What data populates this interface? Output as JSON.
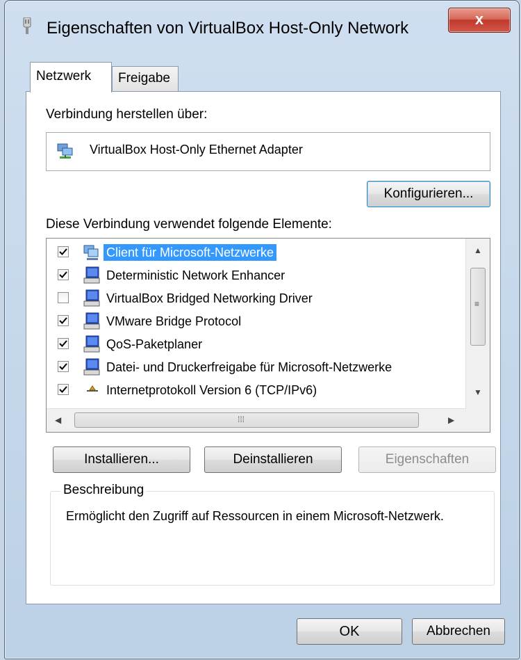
{
  "window": {
    "title": "Eigenschaften von VirtualBox Host-Only Network",
    "close_symbol": "x"
  },
  "tabs": [
    {
      "label": "Netzwerk",
      "active": true
    },
    {
      "label": "Freigabe",
      "active": false
    }
  ],
  "connection": {
    "label": "Verbindung herstellen über:",
    "adapter": "VirtualBox Host-Only Ethernet Adapter",
    "adapter_icon": "network-adapter-icon",
    "configure_button": "Konfigurieren..."
  },
  "elements": {
    "label": "Diese Verbindung verwendet folgende Elemente:",
    "items": [
      {
        "label": "Client für Microsoft-Netzwerke",
        "checked": true,
        "selected": true,
        "icon": "network-client-icon"
      },
      {
        "label": "Deterministic Network Enhancer",
        "checked": true,
        "selected": false,
        "icon": "network-service-icon"
      },
      {
        "label": "VirtualBox Bridged Networking Driver",
        "checked": false,
        "selected": false,
        "icon": "network-service-icon"
      },
      {
        "label": "VMware Bridge Protocol",
        "checked": true,
        "selected": false,
        "icon": "network-service-icon"
      },
      {
        "label": "QoS-Paketplaner",
        "checked": true,
        "selected": false,
        "icon": "network-service-icon"
      },
      {
        "label": "Datei- und Druckerfreigabe für Microsoft-Netzwerke",
        "checked": true,
        "selected": false,
        "icon": "network-service-icon"
      },
      {
        "label": "Internetprotokoll Version 6 (TCP/IPv6)",
        "checked": true,
        "selected": false,
        "icon": "protocol-icon"
      }
    ]
  },
  "buttons": {
    "install": "Installieren...",
    "uninstall": "Deinstallieren",
    "properties": "Eigenschaften",
    "ok": "OK",
    "cancel": "Abbrechen"
  },
  "description": {
    "title": "Beschreibung",
    "text": "Ermöglicht den Zugriff auf Ressourcen in einem Microsoft-Netzwerk."
  },
  "colors": {
    "selection": "#3399ff",
    "close_button": "#c0392b"
  }
}
